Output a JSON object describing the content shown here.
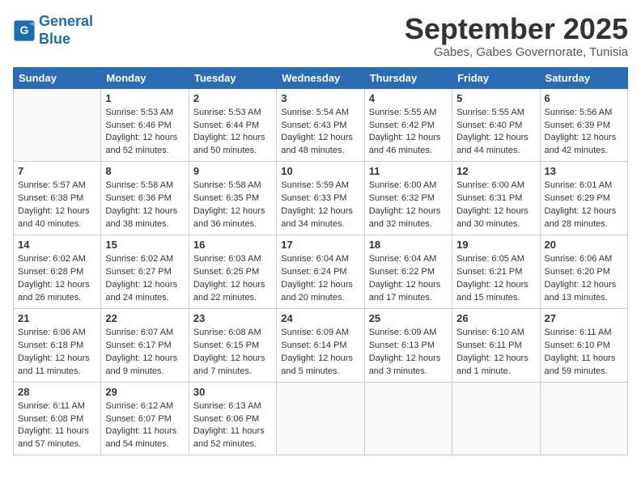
{
  "logo": {
    "line1": "General",
    "line2": "Blue"
  },
  "title": "September 2025",
  "subtitle": "Gabes, Gabes Governorate, Tunisia",
  "weekdays": [
    "Sunday",
    "Monday",
    "Tuesday",
    "Wednesday",
    "Thursday",
    "Friday",
    "Saturday"
  ],
  "weeks": [
    [
      {
        "day": "",
        "info": ""
      },
      {
        "day": "1",
        "info": "Sunrise: 5:53 AM\nSunset: 6:46 PM\nDaylight: 12 hours\nand 52 minutes."
      },
      {
        "day": "2",
        "info": "Sunrise: 5:53 AM\nSunset: 6:44 PM\nDaylight: 12 hours\nand 50 minutes."
      },
      {
        "day": "3",
        "info": "Sunrise: 5:54 AM\nSunset: 6:43 PM\nDaylight: 12 hours\nand 48 minutes."
      },
      {
        "day": "4",
        "info": "Sunrise: 5:55 AM\nSunset: 6:42 PM\nDaylight: 12 hours\nand 46 minutes."
      },
      {
        "day": "5",
        "info": "Sunrise: 5:55 AM\nSunset: 6:40 PM\nDaylight: 12 hours\nand 44 minutes."
      },
      {
        "day": "6",
        "info": "Sunrise: 5:56 AM\nSunset: 6:39 PM\nDaylight: 12 hours\nand 42 minutes."
      }
    ],
    [
      {
        "day": "7",
        "info": "Sunrise: 5:57 AM\nSunset: 6:38 PM\nDaylight: 12 hours\nand 40 minutes."
      },
      {
        "day": "8",
        "info": "Sunrise: 5:58 AM\nSunset: 6:36 PM\nDaylight: 12 hours\nand 38 minutes."
      },
      {
        "day": "9",
        "info": "Sunrise: 5:58 AM\nSunset: 6:35 PM\nDaylight: 12 hours\nand 36 minutes."
      },
      {
        "day": "10",
        "info": "Sunrise: 5:59 AM\nSunset: 6:33 PM\nDaylight: 12 hours\nand 34 minutes."
      },
      {
        "day": "11",
        "info": "Sunrise: 6:00 AM\nSunset: 6:32 PM\nDaylight: 12 hours\nand 32 minutes."
      },
      {
        "day": "12",
        "info": "Sunrise: 6:00 AM\nSunset: 6:31 PM\nDaylight: 12 hours\nand 30 minutes."
      },
      {
        "day": "13",
        "info": "Sunrise: 6:01 AM\nSunset: 6:29 PM\nDaylight: 12 hours\nand 28 minutes."
      }
    ],
    [
      {
        "day": "14",
        "info": "Sunrise: 6:02 AM\nSunset: 6:28 PM\nDaylight: 12 hours\nand 26 minutes."
      },
      {
        "day": "15",
        "info": "Sunrise: 6:02 AM\nSunset: 6:27 PM\nDaylight: 12 hours\nand 24 minutes."
      },
      {
        "day": "16",
        "info": "Sunrise: 6:03 AM\nSunset: 6:25 PM\nDaylight: 12 hours\nand 22 minutes."
      },
      {
        "day": "17",
        "info": "Sunrise: 6:04 AM\nSunset: 6:24 PM\nDaylight: 12 hours\nand 20 minutes."
      },
      {
        "day": "18",
        "info": "Sunrise: 6:04 AM\nSunset: 6:22 PM\nDaylight: 12 hours\nand 17 minutes."
      },
      {
        "day": "19",
        "info": "Sunrise: 6:05 AM\nSunset: 6:21 PM\nDaylight: 12 hours\nand 15 minutes."
      },
      {
        "day": "20",
        "info": "Sunrise: 6:06 AM\nSunset: 6:20 PM\nDaylight: 12 hours\nand 13 minutes."
      }
    ],
    [
      {
        "day": "21",
        "info": "Sunrise: 6:06 AM\nSunset: 6:18 PM\nDaylight: 12 hours\nand 11 minutes."
      },
      {
        "day": "22",
        "info": "Sunrise: 6:07 AM\nSunset: 6:17 PM\nDaylight: 12 hours\nand 9 minutes."
      },
      {
        "day": "23",
        "info": "Sunrise: 6:08 AM\nSunset: 6:15 PM\nDaylight: 12 hours\nand 7 minutes."
      },
      {
        "day": "24",
        "info": "Sunrise: 6:09 AM\nSunset: 6:14 PM\nDaylight: 12 hours\nand 5 minutes."
      },
      {
        "day": "25",
        "info": "Sunrise: 6:09 AM\nSunset: 6:13 PM\nDaylight: 12 hours\nand 3 minutes."
      },
      {
        "day": "26",
        "info": "Sunrise: 6:10 AM\nSunset: 6:11 PM\nDaylight: 12 hours\nand 1 minute."
      },
      {
        "day": "27",
        "info": "Sunrise: 6:11 AM\nSunset: 6:10 PM\nDaylight: 11 hours\nand 59 minutes."
      }
    ],
    [
      {
        "day": "28",
        "info": "Sunrise: 6:11 AM\nSunset: 6:08 PM\nDaylight: 11 hours\nand 57 minutes."
      },
      {
        "day": "29",
        "info": "Sunrise: 6:12 AM\nSunset: 6:07 PM\nDaylight: 11 hours\nand 54 minutes."
      },
      {
        "day": "30",
        "info": "Sunrise: 6:13 AM\nSunset: 6:06 PM\nDaylight: 11 hours\nand 52 minutes."
      },
      {
        "day": "",
        "info": ""
      },
      {
        "day": "",
        "info": ""
      },
      {
        "day": "",
        "info": ""
      },
      {
        "day": "",
        "info": ""
      }
    ]
  ]
}
